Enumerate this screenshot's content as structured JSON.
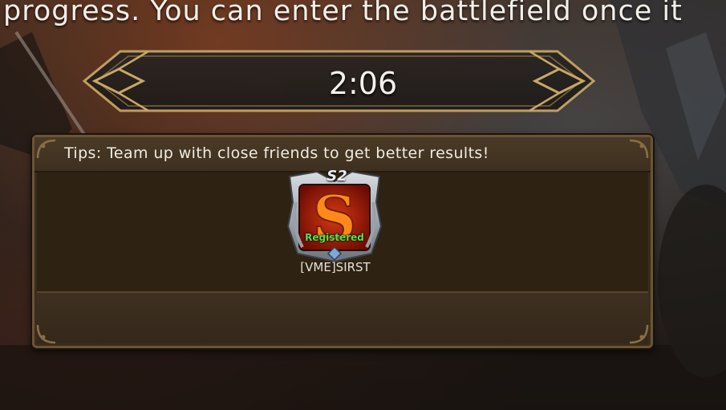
{
  "notice": {
    "text": "progress. You can enter the battlefield once it"
  },
  "timer": {
    "value": "2:06"
  },
  "lobby": {
    "tips": "Tips: Team up with close friends to get better results!",
    "members": [
      {
        "season": "S2",
        "emblem_letter": "S",
        "status": "Registered",
        "name": "[VME]SIRST"
      }
    ]
  },
  "colors": {
    "panel_bg": "#3b2d1c",
    "panel_border": "#6b5434",
    "timer_gold": "#c9a766",
    "registered_green": "#58e048",
    "emblem_red": "#a01608"
  }
}
